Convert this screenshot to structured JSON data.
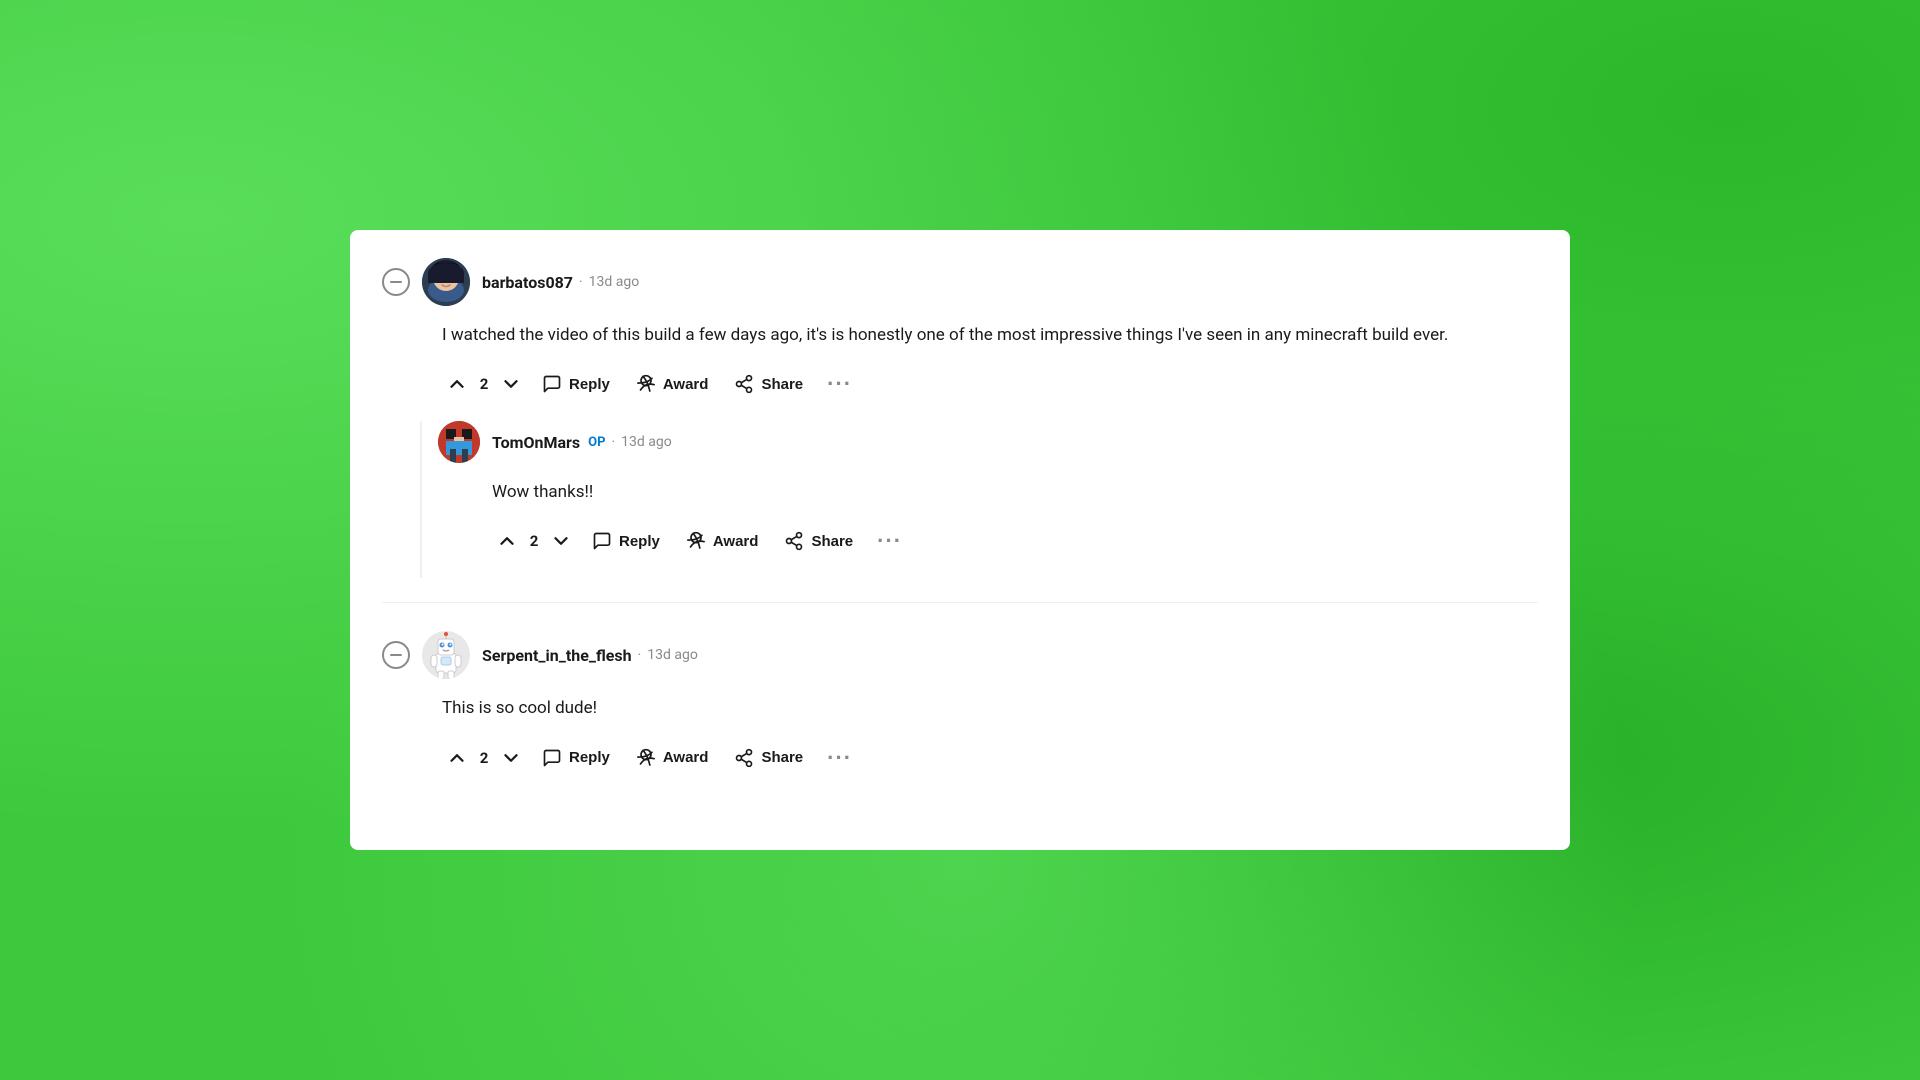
{
  "background": {
    "color": "#3dc93d"
  },
  "comments": [
    {
      "id": "comment-1",
      "username": "barbatos087",
      "timestamp": "13d ago",
      "text": "I watched the video of this build a few days ago, it's is honestly one of the most impressive things I've seen in any minecraft build ever.",
      "vote_count": "2",
      "op": false,
      "actions": {
        "reply": "Reply",
        "award": "Award",
        "share": "Share"
      },
      "replies": [
        {
          "id": "reply-1",
          "username": "TomOnMars",
          "op": true,
          "timestamp": "13d ago",
          "text": "Wow thanks!!",
          "vote_count": "2",
          "actions": {
            "reply": "Reply",
            "award": "Award",
            "share": "Share"
          }
        }
      ]
    },
    {
      "id": "comment-2",
      "username": "Serpent_in_the_flesh",
      "timestamp": "13d ago",
      "text": "This is so cool dude!",
      "vote_count": "2",
      "op": false,
      "actions": {
        "reply": "Reply",
        "award": "Award",
        "share": "Share"
      },
      "replies": []
    }
  ],
  "labels": {
    "op": "OP",
    "dot": "·"
  }
}
